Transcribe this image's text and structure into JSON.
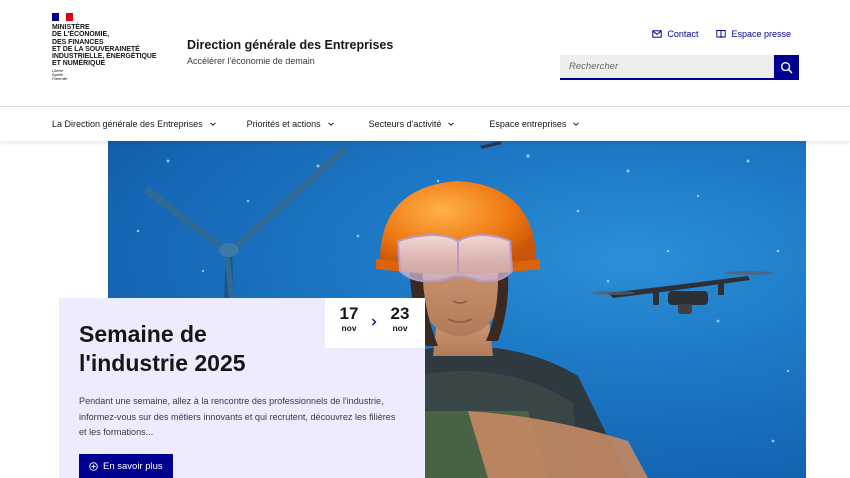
{
  "header": {
    "ministry_lines": [
      "Ministère",
      "de l'économie,",
      "des finances",
      "et de la souveraineté",
      "industrielle, énergétique",
      "et numérique"
    ],
    "devise_lines": [
      "Liberté",
      "Égalité",
      "Fraternité"
    ],
    "service_title": "Direction générale des Entreprises",
    "service_tagline": "Accélérer l'économie de demain",
    "quick_links": [
      {
        "label": "Contact",
        "icon": "mail-icon"
      },
      {
        "label": "Espace presse",
        "icon": "book-icon"
      }
    ],
    "search": {
      "placeholder": "Rechercher",
      "button_icon": "search-icon"
    }
  },
  "nav": {
    "items": [
      {
        "label": "La Direction générale des Entreprises"
      },
      {
        "label": "Priorités et actions"
      },
      {
        "label": "Secteurs d'activité"
      },
      {
        "label": "Espace entreprises"
      }
    ]
  },
  "hero": {
    "title_lines": [
      "Semaine de",
      "l'industrie 2025"
    ],
    "description": "Pendant une semaine, allez à la rencontre des professionnels de l'industrie, informez-vous sur des métiers innovants et qui recrutent, découvrez les filières et les formations...",
    "cta_label": "En savoir plus",
    "date": {
      "start_day": "17",
      "start_month": "nov",
      "end_day": "23",
      "end_month": "nov"
    }
  },
  "colors": {
    "brand_blue": "#000091",
    "flag_blue": "#000091",
    "flag_red": "#e1000f",
    "card_bg": "#ececfe"
  }
}
